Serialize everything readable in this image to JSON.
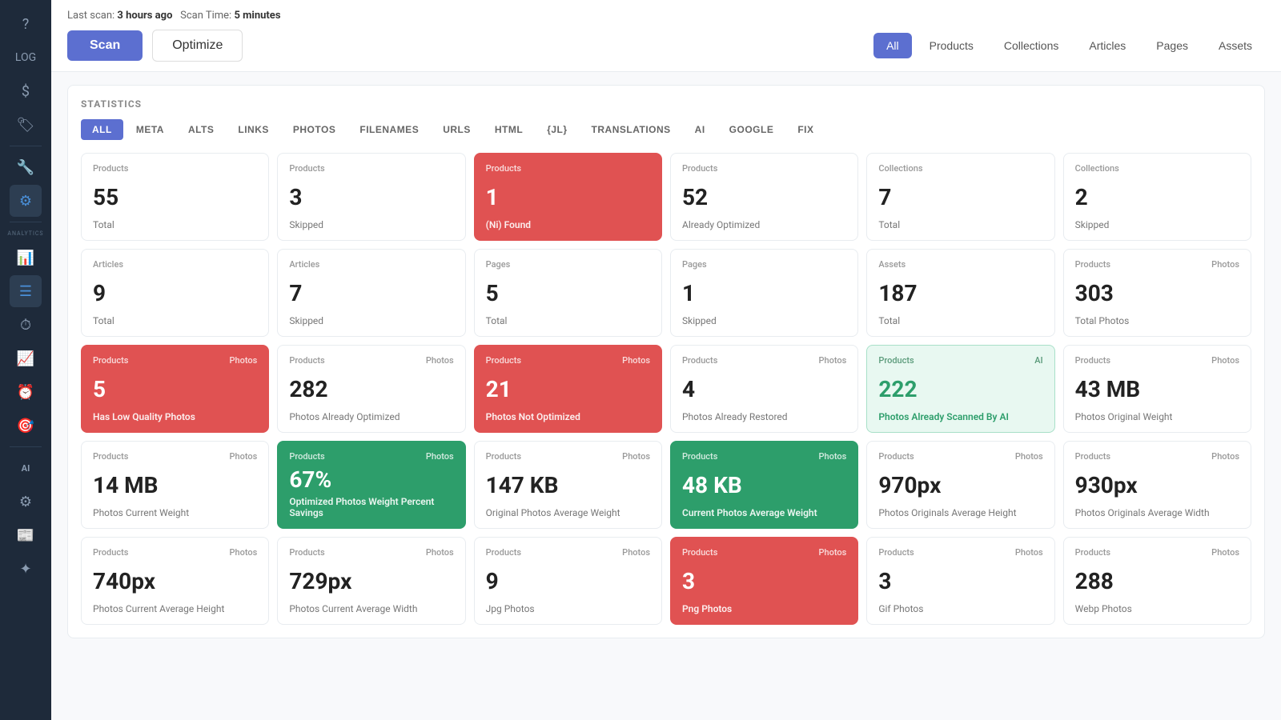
{
  "meta": {
    "last_scan_label": "Last scan:",
    "last_scan_time": "3 hours ago",
    "scan_time_label": "Scan Time:",
    "scan_time_value": "5 minutes"
  },
  "toolbar": {
    "scan_label": "Scan",
    "optimize_label": "Optimize"
  },
  "filter_tabs": [
    {
      "id": "all",
      "label": "All",
      "active": true
    },
    {
      "id": "products",
      "label": "Products",
      "active": false
    },
    {
      "id": "collections",
      "label": "Collections",
      "active": false
    },
    {
      "id": "articles",
      "label": "Articles",
      "active": false
    },
    {
      "id": "pages",
      "label": "Pages",
      "active": false
    },
    {
      "id": "assets",
      "label": "Assets",
      "active": false
    }
  ],
  "statistics": {
    "title": "STATISTICS",
    "cat_tabs": [
      {
        "id": "all",
        "label": "ALL",
        "active": true
      },
      {
        "id": "meta",
        "label": "META"
      },
      {
        "id": "alts",
        "label": "ALTS"
      },
      {
        "id": "links",
        "label": "LINKS"
      },
      {
        "id": "photos",
        "label": "PHOTOS"
      },
      {
        "id": "filenames",
        "label": "FILENAMES"
      },
      {
        "id": "urls",
        "label": "URLS"
      },
      {
        "id": "html",
        "label": "HTML"
      },
      {
        "id": "jl",
        "label": "{JL}"
      },
      {
        "id": "translations",
        "label": "TRANSLATIONS"
      },
      {
        "id": "ai",
        "label": "AI"
      },
      {
        "id": "google",
        "label": "GOOGLE"
      },
      {
        "id": "fix",
        "label": "FIX"
      }
    ],
    "cards": [
      {
        "category": "Products",
        "subcategory": "",
        "value": "55",
        "label": "Total",
        "style": "normal"
      },
      {
        "category": "Products",
        "subcategory": "",
        "value": "3",
        "label": "Skipped",
        "style": "normal"
      },
      {
        "category": "Products",
        "subcategory": "",
        "value": "1",
        "label": "(Ni) Found",
        "style": "red"
      },
      {
        "category": "Products",
        "subcategory": "",
        "value": "52",
        "label": "Already Optimized",
        "style": "normal"
      },
      {
        "category": "Collections",
        "subcategory": "",
        "value": "7",
        "label": "Total",
        "style": "normal"
      },
      {
        "category": "Collections",
        "subcategory": "",
        "value": "2",
        "label": "Skipped",
        "style": "normal"
      },
      {
        "category": "Articles",
        "subcategory": "",
        "value": "9",
        "label": "Total",
        "style": "normal"
      },
      {
        "category": "Articles",
        "subcategory": "",
        "value": "7",
        "label": "Skipped",
        "style": "normal"
      },
      {
        "category": "Pages",
        "subcategory": "",
        "value": "5",
        "label": "Total",
        "style": "normal"
      },
      {
        "category": "Pages",
        "subcategory": "",
        "value": "1",
        "label": "Skipped",
        "style": "normal"
      },
      {
        "category": "Assets",
        "subcategory": "",
        "value": "187",
        "label": "Total",
        "style": "normal"
      },
      {
        "category": "Products",
        "subcategory": "Photos",
        "value": "303",
        "label": "Total Photos",
        "style": "normal"
      },
      {
        "category": "Products",
        "subcategory": "Photos",
        "value": "5",
        "label": "Has Low Quality Photos",
        "style": "red"
      },
      {
        "category": "Products",
        "subcategory": "Photos",
        "value": "282",
        "label": "Photos Already Optimized",
        "style": "normal"
      },
      {
        "category": "Products",
        "subcategory": "Photos",
        "value": "21",
        "label": "Photos Not Optimized",
        "style": "red"
      },
      {
        "category": "Products",
        "subcategory": "Photos",
        "value": "4",
        "label": "Photos Already Restored",
        "style": "normal"
      },
      {
        "category": "Products",
        "subcategory": "AI",
        "value": "222",
        "label": "Photos Already Scanned By AI",
        "style": "mint"
      },
      {
        "category": "Products",
        "subcategory": "Photos",
        "value": "43 MB",
        "label": "Photos Original Weight",
        "style": "normal"
      },
      {
        "category": "Products",
        "subcategory": "Photos",
        "value": "14 MB",
        "label": "Photos Current Weight",
        "style": "normal"
      },
      {
        "category": "Products",
        "subcategory": "Photos",
        "value": "67%",
        "label": "Optimized Photos Weight Percent Savings",
        "style": "green"
      },
      {
        "category": "Products",
        "subcategory": "Photos",
        "value": "147 KB",
        "label": "Original Photos Average Weight",
        "style": "normal"
      },
      {
        "category": "Products",
        "subcategory": "Photos",
        "value": "48 KB",
        "label": "Current Photos Average Weight",
        "style": "green"
      },
      {
        "category": "Products",
        "subcategory": "Photos",
        "value": "970px",
        "label": "Photos Originals Average Height",
        "style": "normal"
      },
      {
        "category": "Products",
        "subcategory": "Photos",
        "value": "930px",
        "label": "Photos Originals Average Width",
        "style": "normal"
      },
      {
        "category": "Products",
        "subcategory": "Photos",
        "value": "740px",
        "label": "Photos Current Average Height",
        "style": "normal"
      },
      {
        "category": "Products",
        "subcategory": "Photos",
        "value": "729px",
        "label": "Photos Current Average Width",
        "style": "normal"
      },
      {
        "category": "Products",
        "subcategory": "Photos",
        "value": "9",
        "label": "Jpg Photos",
        "style": "normal"
      },
      {
        "category": "Products",
        "subcategory": "Photos",
        "value": "3",
        "label": "Png Photos",
        "style": "red"
      },
      {
        "category": "Products",
        "subcategory": "Photos",
        "value": "3",
        "label": "Gif Photos",
        "style": "normal"
      },
      {
        "category": "Products",
        "subcategory": "Photos",
        "value": "288",
        "label": "Webp Photos",
        "style": "normal"
      }
    ]
  },
  "sidebar": {
    "icons": [
      {
        "id": "help",
        "symbol": "?",
        "label": ""
      },
      {
        "id": "log",
        "symbol": "📋",
        "label": "LOG"
      },
      {
        "id": "dollar",
        "symbol": "$",
        "label": ""
      },
      {
        "id": "tag",
        "symbol": "🏷",
        "label": ""
      },
      {
        "id": "wrench",
        "symbol": "🔧",
        "label": ""
      },
      {
        "id": "gear",
        "symbol": "⚙",
        "label": ""
      },
      {
        "id": "analytics-label",
        "symbol": "",
        "label": "ANALYTICS"
      },
      {
        "id": "chart-list",
        "symbol": "📊",
        "label": ""
      },
      {
        "id": "table",
        "symbol": "☰",
        "label": ""
      },
      {
        "id": "clock",
        "symbol": "⏱",
        "label": ""
      },
      {
        "id": "bar-chart",
        "symbol": "📈",
        "label": ""
      },
      {
        "id": "circle-clock",
        "symbol": "⏰",
        "label": ""
      },
      {
        "id": "target",
        "symbol": "🎯",
        "label": ""
      },
      {
        "id": "ai",
        "symbol": "AI",
        "label": ""
      },
      {
        "id": "settings2",
        "symbol": "⚙",
        "label": ""
      },
      {
        "id": "news",
        "symbol": "📰",
        "label": ""
      },
      {
        "id": "star",
        "symbol": "✦",
        "label": ""
      }
    ]
  }
}
